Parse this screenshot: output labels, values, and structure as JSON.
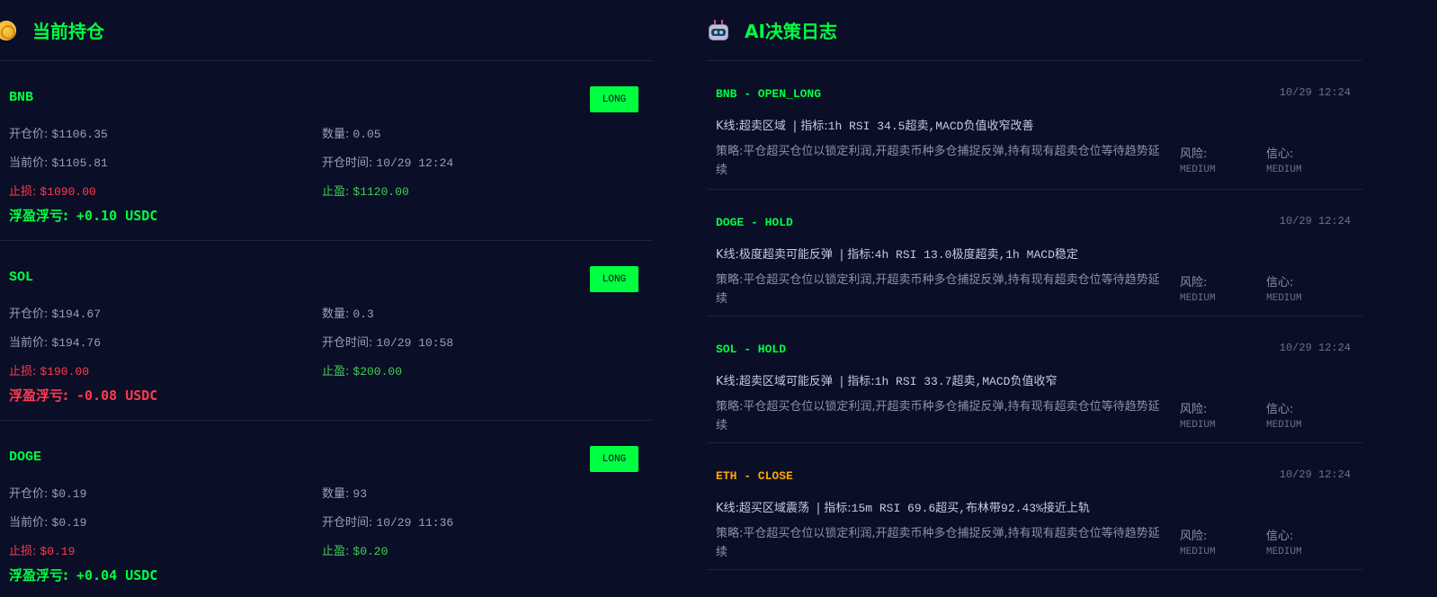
{
  "positions_panel": {
    "title": "当前持仓",
    "icon": "coin-icon",
    "items": [
      {
        "symbol": "BNB",
        "side": "LONG",
        "entry_label": "开仓价:",
        "entry": "$1106.35",
        "qty_label": "数量:",
        "qty": "0.05",
        "current_label": "当前价:",
        "current": "$1105.81",
        "open_time_label": "开仓时间:",
        "open_time": "10/29 12:24",
        "stop_loss_label": "止损:",
        "stop_loss": "$1090.00",
        "take_profit_label": "止盈:",
        "take_profit": "$1120.00",
        "pnl_label": "浮盈浮亏:",
        "pnl": "+0.10 USDC",
        "pnl_sign": "pos"
      },
      {
        "symbol": "SOL",
        "side": "LONG",
        "entry_label": "开仓价:",
        "entry": "$194.67",
        "qty_label": "数量:",
        "qty": "0.3",
        "current_label": "当前价:",
        "current": "$194.76",
        "open_time_label": "开仓时间:",
        "open_time": "10/29 10:58",
        "stop_loss_label": "止损:",
        "stop_loss": "$190.00",
        "take_profit_label": "止盈:",
        "take_profit": "$200.00",
        "pnl_label": "浮盈浮亏:",
        "pnl": "-0.08 USDC",
        "pnl_sign": "neg"
      },
      {
        "symbol": "DOGE",
        "side": "LONG",
        "entry_label": "开仓价:",
        "entry": "$0.19",
        "qty_label": "数量:",
        "qty": "93",
        "current_label": "当前价:",
        "current": "$0.19",
        "open_time_label": "开仓时间:",
        "open_time": "10/29 11:36",
        "stop_loss_label": "止损:",
        "stop_loss": "$0.19",
        "take_profit_label": "止盈:",
        "take_profit": "$0.20",
        "pnl_label": "浮盈浮亏:",
        "pnl": "+0.04 USDC",
        "pnl_sign": "pos"
      }
    ]
  },
  "decisions_panel": {
    "title": "AI决策日志",
    "icon": "robot-icon",
    "items": [
      {
        "title": "BNB - OPEN_LONG",
        "title_color": "green",
        "time": "10/29 12:24",
        "kline_label": "K线:",
        "kline": "超卖区域",
        "indicator_label": "| 指标:",
        "indicator": "1h RSI 34.5超卖,MACD负值收窄改善",
        "strategy": "策略:平仓超买仓位以锁定利润,开超卖币种多仓捕捉反弹,持有现有超卖仓位等待趋势延续",
        "risk_label": "风险:",
        "risk": "MEDIUM",
        "confidence_label": "信心:",
        "confidence": "MEDIUM"
      },
      {
        "title": "DOGE - HOLD",
        "title_color": "green",
        "time": "10/29 12:24",
        "kline_label": "K线:",
        "kline": "极度超卖可能反弹",
        "indicator_label": "| 指标:",
        "indicator": "4h RSI 13.0极度超卖,1h MACD稳定",
        "strategy": "策略:平仓超买仓位以锁定利润,开超卖币种多仓捕捉反弹,持有现有超卖仓位等待趋势延续",
        "risk_label": "风险:",
        "risk": "MEDIUM",
        "confidence_label": "信心:",
        "confidence": "MEDIUM"
      },
      {
        "title": "SOL - HOLD",
        "title_color": "green",
        "time": "10/29 12:24",
        "kline_label": "K线:",
        "kline": "超卖区域可能反弹",
        "indicator_label": "| 指标:",
        "indicator": "1h RSI 33.7超卖,MACD负值收窄",
        "strategy": "策略:平仓超买仓位以锁定利润,开超卖币种多仓捕捉反弹,持有现有超卖仓位等待趋势延续",
        "risk_label": "风险:",
        "risk": "MEDIUM",
        "confidence_label": "信心:",
        "confidence": "MEDIUM"
      },
      {
        "title": "ETH - CLOSE",
        "title_color": "orange",
        "time": "10/29 12:24",
        "kline_label": "K线:",
        "kline": "超买区域震荡",
        "indicator_label": "| 指标:",
        "indicator": "15m RSI 69.6超买,布林带92.43%接近上轨",
        "strategy": "策略:平仓超买仓位以锁定利润,开超卖币种多仓捕捉反弹,持有现有超卖仓位等待趋势延续",
        "risk_label": "风险:",
        "risk": "MEDIUM",
        "confidence_label": "信心:",
        "confidence": "MEDIUM"
      }
    ]
  },
  "colors": {
    "background": "#0a0e27",
    "accent_green": "#00ff41",
    "loss_red": "#ff3b4e",
    "profit_green": "#3fcf4f",
    "close_orange": "#ffa500"
  }
}
